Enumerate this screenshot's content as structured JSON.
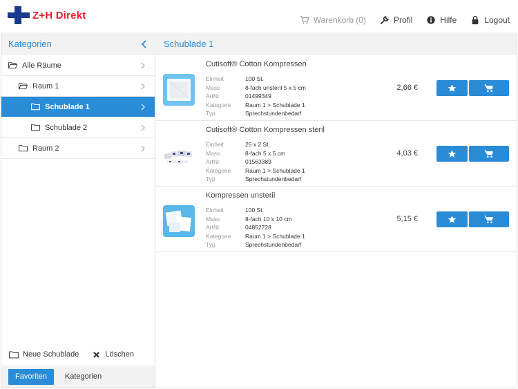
{
  "brand": {
    "name": "Z+H Direkt"
  },
  "topnav": {
    "cart": "Warenkorb (0)",
    "profile": "Profil",
    "help": "Hilfe",
    "logout": "Logout"
  },
  "sidebar": {
    "title": "Kategorien",
    "tree": [
      {
        "label": "Alle Räume",
        "level": 0,
        "active": false,
        "open": true
      },
      {
        "label": "Raum 1",
        "level": 1,
        "active": false,
        "open": true
      },
      {
        "label": "Schublade 1",
        "level": 2,
        "active": true,
        "open": false
      },
      {
        "label": "Schublade 2",
        "level": 2,
        "active": false,
        "open": false
      },
      {
        "label": "Raum 2",
        "level": 1,
        "active": false,
        "open": false
      }
    ],
    "new_drawer": "Neue Schublade",
    "delete": "Löschen",
    "favorites_button": "Favoriten",
    "categories_link": "Kategorien"
  },
  "main": {
    "title": "Schublade 1",
    "attr_labels": {
      "unit": "Einheit",
      "size": "Mass",
      "art": "ArtNr",
      "category": "Kategorie",
      "type": "Typ"
    },
    "products": [
      {
        "name": "Cutisoft® Cotton Kompressen",
        "unit": "100 St.",
        "size": "8-fach unsteril 5 x 5 cm",
        "art": "01499349",
        "category": "Raum 1 > Schublade 1",
        "type": "Sprechstundenbedarf",
        "price": "2,66 €"
      },
      {
        "name": "Cutisoft® Cotton Kompressen steril",
        "unit": "25 x 2 St.",
        "size": "8-fach 5 x 5 cm",
        "art": "01563389",
        "category": "Raum 1 > Schublade 1",
        "type": "Sprechstundenbedarf",
        "price": "4,03 €"
      },
      {
        "name": "Kompressen unsteril",
        "unit": "100 St.",
        "size": "8-fach 10 x 10 cm",
        "art": "04852728",
        "category": "Raum 1 > Schublade 1",
        "type": "Sprechstundenbedarf",
        "price": "5,15 €"
      }
    ]
  },
  "colors": {
    "accent": "#2a8bd6",
    "brand_red": "#e2202b",
    "brand_blue": "#1a3a8f"
  }
}
